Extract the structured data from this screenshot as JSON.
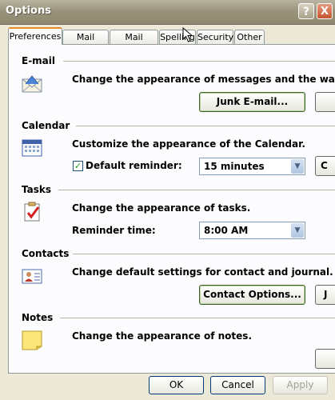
{
  "window": {
    "title": "Options"
  },
  "titlebar": {
    "help_glyph": "?",
    "close_glyph": "X"
  },
  "tabs": [
    {
      "label": "Preferences",
      "active": true
    },
    {
      "label": "Mail Setup"
    },
    {
      "label": "Mail Format"
    },
    {
      "label": "Spelling"
    },
    {
      "label": "Security"
    },
    {
      "label": "Other"
    }
  ],
  "sections": {
    "email": {
      "heading": "E-mail",
      "description": "Change the appearance of messages and the way t",
      "button": "Junk E-mail...",
      "icon": "envelope-icon"
    },
    "calendar": {
      "heading": "Calendar",
      "description": "Customize the appearance of the Calendar.",
      "checkbox_label": "Default reminder:",
      "checkbox_checked": true,
      "reminder_value": "15 minutes",
      "edge_button": "C",
      "icon": "calendar-icon"
    },
    "tasks": {
      "heading": "Tasks",
      "description": "Change the appearance of tasks.",
      "reminder_label": "Reminder time:",
      "reminder_value": "8:00 AM",
      "icon": "tasks-icon"
    },
    "contacts": {
      "heading": "Contacts",
      "description": "Change default settings for contact and journal.",
      "button": "Contact Options...",
      "edge_button": "J",
      "icon": "contact-card-icon"
    },
    "notes": {
      "heading": "Notes",
      "description": "Change the appearance of notes.",
      "icon": "sticky-note-icon"
    }
  },
  "footer": {
    "ok": "OK",
    "cancel": "Cancel",
    "apply": "Apply"
  }
}
